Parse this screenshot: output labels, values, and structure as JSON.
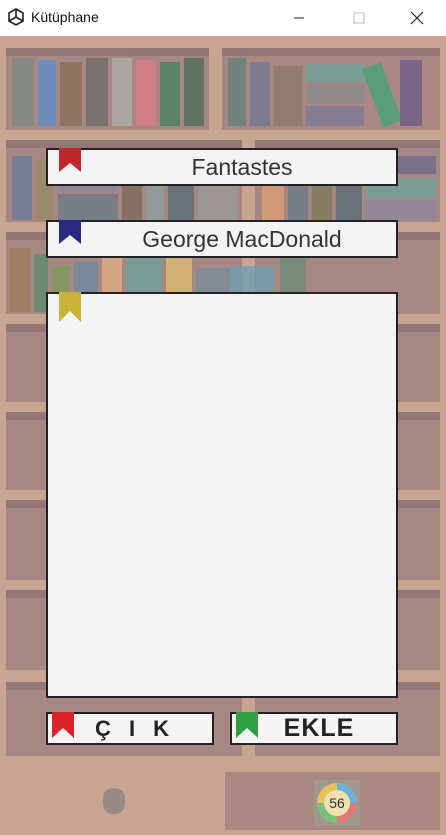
{
  "window": {
    "title": "Kütüphane",
    "app_icon": "unity-icon",
    "controls": [
      "minimize-icon",
      "maximize-icon",
      "close-icon"
    ]
  },
  "form": {
    "book_title": "Fantastes",
    "author": "George MacDonald",
    "description": ""
  },
  "buttons": {
    "exit_label": "Ç I K",
    "add_label": "EKLE"
  },
  "badge": {
    "value": "56"
  },
  "colors": {
    "background": "#c8a492",
    "ribbon_title": "#c0272d",
    "ribbon_author": "#2b2a7e",
    "ribbon_description": "#c9b33a",
    "ribbon_exit": "#d9242c",
    "ribbon_add": "#2ea043",
    "field_fill": "#f4f4f4",
    "border": "#222222"
  }
}
